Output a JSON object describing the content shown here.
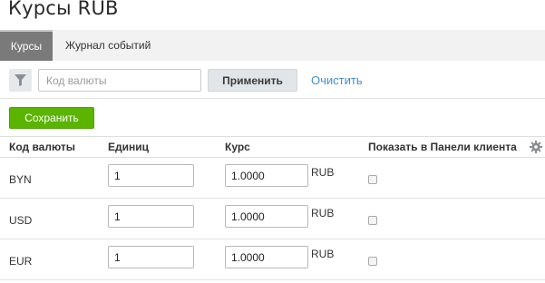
{
  "page": {
    "title": "Курсы RUB"
  },
  "tabs": [
    {
      "label": "Курсы",
      "active": true
    },
    {
      "label": "Журнал событий",
      "active": false
    }
  ],
  "filter": {
    "icon": "filter-icon",
    "placeholder": "Код валюты",
    "value": "",
    "apply_label": "Применить",
    "clear_label": "Очистить"
  },
  "actions": {
    "save_label": "Сохранить"
  },
  "table": {
    "headers": {
      "code": "Код валюты",
      "units": "Единиц",
      "rate": "Курс",
      "show": "Показать в Панели клиента",
      "settings_icon": "gear-icon"
    },
    "rows": [
      {
        "code": "BYN",
        "units": "1",
        "rate": "1.0000",
        "unit": "RUB",
        "show": false
      },
      {
        "code": "USD",
        "units": "1",
        "rate": "1.0000",
        "unit": "RUB",
        "show": false
      },
      {
        "code": "EUR",
        "units": "1",
        "rate": "1.0000",
        "unit": "RUB",
        "show": false
      }
    ]
  },
  "colors": {
    "accent_green": "#5ab400",
    "link_blue": "#3d8fd1",
    "active_tab": "#7a7a7a"
  }
}
